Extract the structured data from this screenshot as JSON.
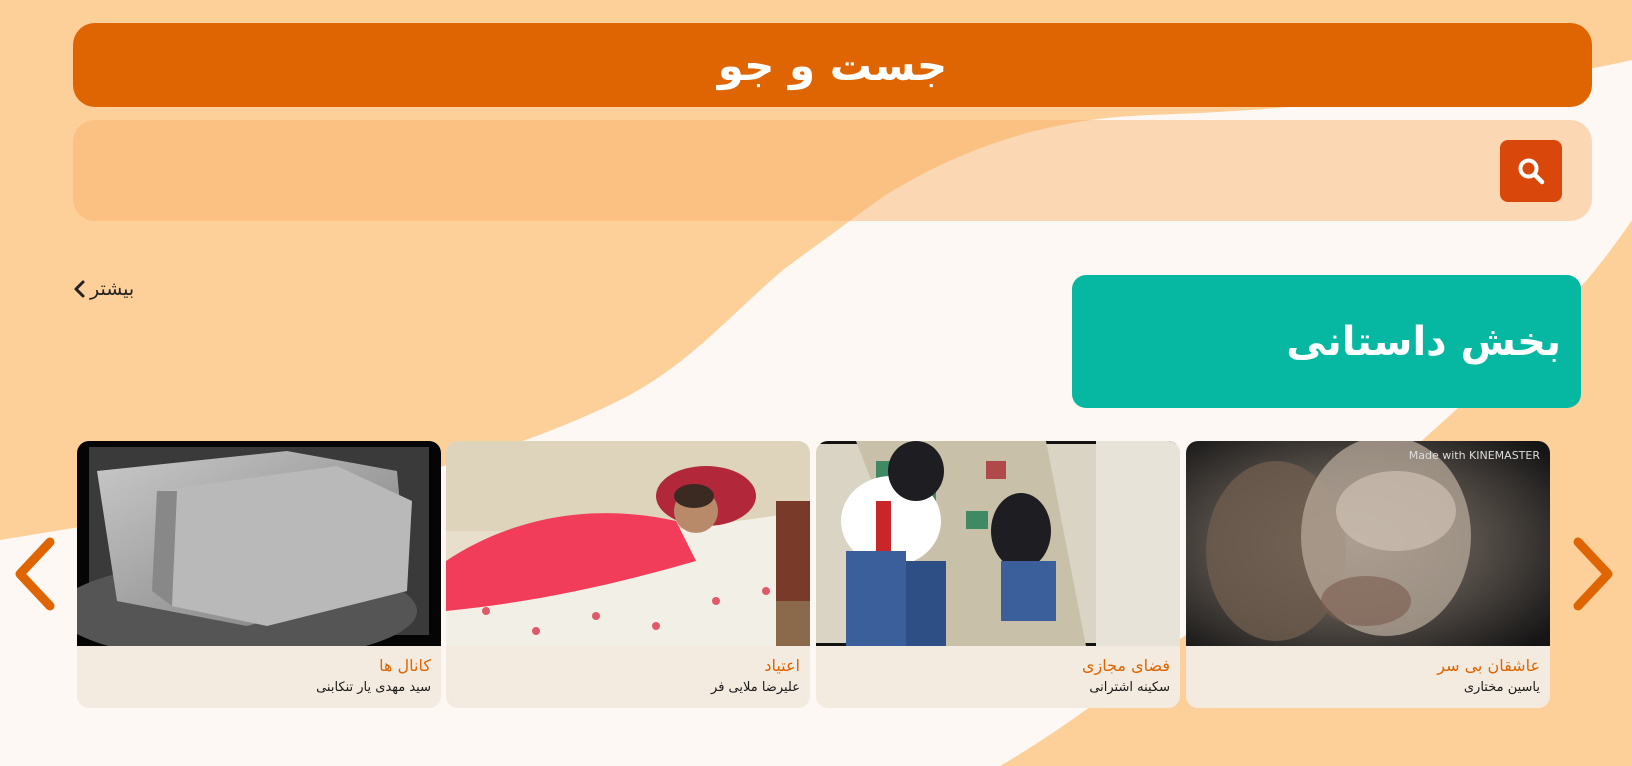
{
  "colors": {
    "header_bg": "#df6402",
    "search_button_bg": "#d9470a",
    "section_title_bg": "#06b8a1",
    "card_title_color": "#df6402",
    "background_wave": "#fdd09a",
    "page_bg": "#fdf8f3"
  },
  "search": {
    "header_title": "جست و جو",
    "placeholder": "",
    "value": "",
    "button_icon": "search-icon"
  },
  "section": {
    "title": "بخش داستانی",
    "more_label": "بیشتر",
    "more_icon": "chevron-left-icon",
    "prev_icon": "chevron-left-icon",
    "next_icon": "chevron-right-icon",
    "cards": [
      {
        "title": "عاشقان بی سر",
        "author": "یاسین مختاری",
        "watermark": "Made with KINEMASTER"
      },
      {
        "title": "فضای مجازی",
        "author": "سکینه اشترانی"
      },
      {
        "title": "اعتیاد",
        "author": "علیرضا ملایی فر"
      },
      {
        "title": "کانال ها",
        "author": "سید مهدی یار تنکابنی"
      }
    ]
  }
}
